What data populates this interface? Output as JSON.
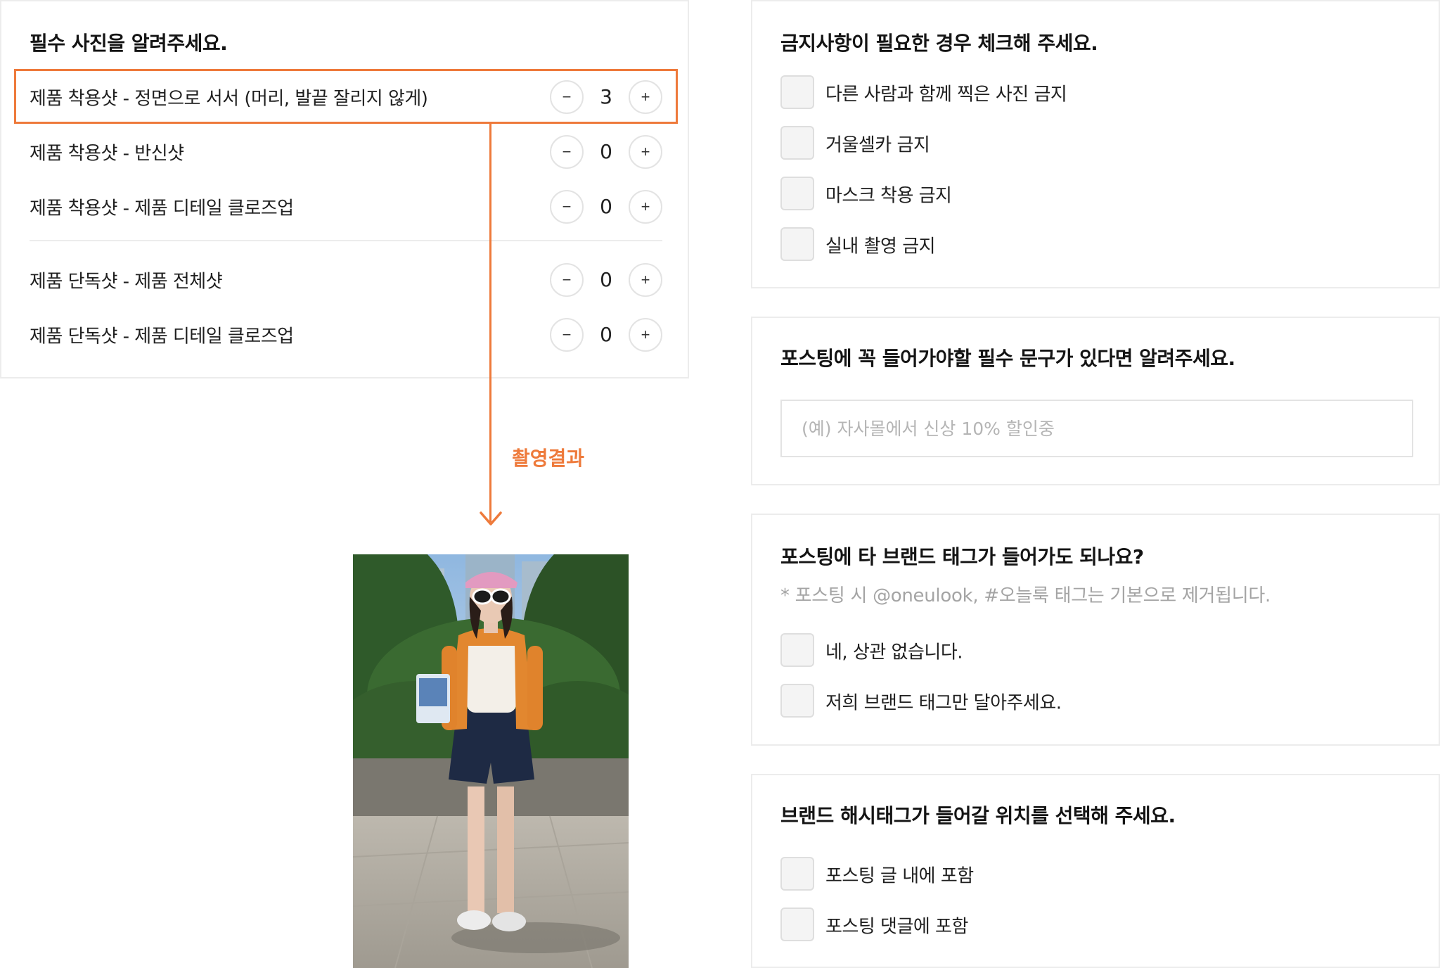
{
  "photo_section": {
    "title": "필수 사진을 알려주세요.",
    "rows": [
      {
        "label": "제품 착용샷 - 정면으로 서서 (머리, 발끝 잘리지 않게)",
        "count": "3",
        "minus": "−",
        "plus": "+"
      },
      {
        "label": "제품 착용샷 - 반신샷",
        "count": "0",
        "minus": "−",
        "plus": "+"
      },
      {
        "label": "제품 착용샷 - 제품 디테일 클로즈업",
        "count": "0",
        "minus": "−",
        "plus": "+"
      },
      {
        "label": "제품 단독샷 - 제품 전체샷",
        "count": "0",
        "minus": "−",
        "plus": "+"
      },
      {
        "label": "제품 단독샷 - 제품 디테일 클로즈업",
        "count": "0",
        "minus": "−",
        "plus": "+"
      }
    ]
  },
  "result": {
    "label": "촬영결과"
  },
  "prohibit_section": {
    "title": "금지사항이 필요한 경우 체크해 주세요.",
    "options": [
      {
        "label": "다른 사람과 함께 찍은 사진 금지"
      },
      {
        "label": "거울셀카 금지"
      },
      {
        "label": "마스크 착용 금지"
      },
      {
        "label": "실내 촬영 금지"
      }
    ]
  },
  "phrase_section": {
    "title": "포스팅에 꼭 들어가야할 필수 문구가 있다면 알려주세요.",
    "input_value": "",
    "input_placeholder": "(예) 자사몰에서 신상 10% 할인중"
  },
  "tag_section": {
    "title": "포스팅에 타 브랜드 태그가 들어가도 되나요?",
    "note": "* 포스팅 시 @oneulook, #오늘룩 태그는 기본으로 제거됩니다.",
    "options": [
      {
        "label": "네, 상관 없습니다."
      },
      {
        "label": "저희 브랜드 태그만 달아주세요."
      }
    ]
  },
  "position_section": {
    "title": "브랜드 해시태그가 들어갈 위치를 선택해 주세요.",
    "options": [
      {
        "label": "포스팅 글 내에 포함"
      },
      {
        "label": "포스팅 댓글에 포함"
      }
    ]
  },
  "colors": {
    "accent": "#ee7a3b",
    "border": "#ececec",
    "checkbox_fill": "#f4f4f4"
  }
}
